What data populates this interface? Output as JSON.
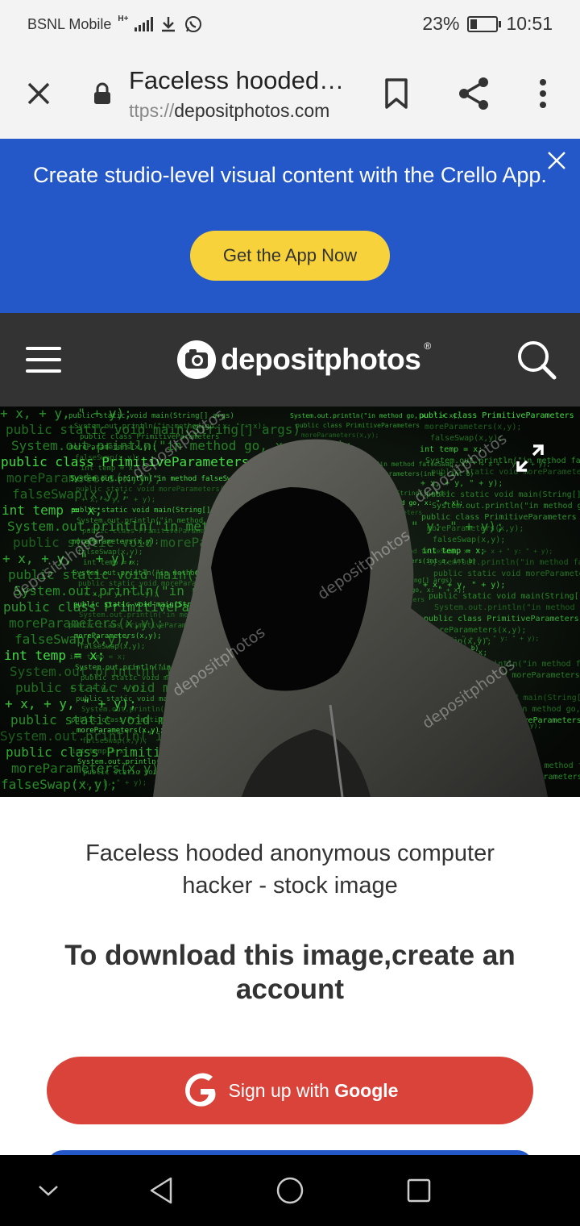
{
  "status_bar": {
    "carrier": "BSNL Mobile",
    "network": "H+",
    "battery": "23%",
    "battery_level": 0.23,
    "time": "10:51"
  },
  "tab": {
    "title": "Faceless hooded…",
    "url_prefix": "ttps://",
    "url_domain": "depositphotos.com"
  },
  "banner": {
    "text": "Create studio-level visual content with the Crello App.",
    "button": "Get the App Now",
    "bg_color": "#2458c8",
    "button_color": "#f7d23a"
  },
  "site": {
    "logo_text": "depositphotos",
    "logo_mark": "®",
    "header_color": "#333333"
  },
  "hero": {
    "watermark": "depositphotos",
    "code_lines": [
      "+ x, + y, \" + y);",
      "public static void main(String[] args)",
      "System.out.println(\"in method go, x: \" + x);",
      "public class PrimitiveParameters",
      "moreParameters(x,y);",
      "falseSwap(x,y);",
      "int temp = x;",
      "System.out.println(\"in method falseSwap, x: \" + x + \" y: \" + y);",
      "public static void moreParameters(int a, int b)"
    ]
  },
  "content": {
    "image_title": "Faceless hooded anonymous computer hacker - stock image",
    "heading": "To download this image,create an account",
    "google_prefix": "Sign up with ",
    "google_brand": "Google",
    "google_color": "#d9433a"
  }
}
